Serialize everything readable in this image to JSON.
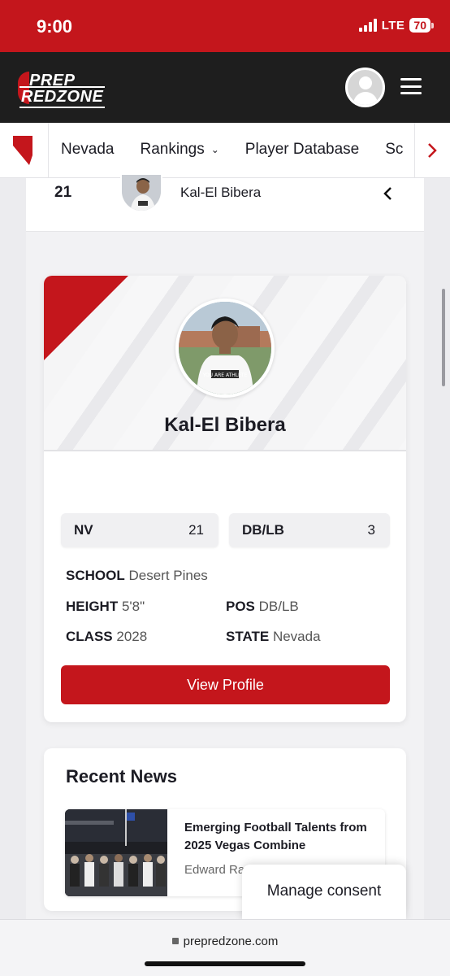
{
  "status_bar": {
    "time": "9:00",
    "network": "LTE",
    "battery": "70"
  },
  "header": {
    "logo_top": "PREP",
    "logo_bottom": "REDZONE"
  },
  "subnav": {
    "items": [
      "Nevada",
      "Rankings",
      "Player Database",
      "Sc"
    ]
  },
  "rank_row": {
    "rank": "21",
    "name": "Kal-El Bibera"
  },
  "player": {
    "name": "Kal-El Bibera",
    "state_abbr": "NV",
    "state_rank": "21",
    "position_group": "DB/LB",
    "position_rank": "3",
    "school_label": "SCHOOL",
    "school": "Desert Pines",
    "height_label": "HEIGHT",
    "height": "5'8\"",
    "pos_label": "POS",
    "pos": "DB/LB",
    "class_label": "CLASS",
    "class": "2028",
    "state_label": "STATE",
    "state": "Nevada",
    "view_profile": "View Profile",
    "shirt_text": "YOU ARE ATHLETE"
  },
  "news": {
    "heading": "Recent News",
    "items": [
      {
        "headline": "Emerging Football Talents from 2025 Vegas Combine",
        "author": "Edward Ra"
      }
    ]
  },
  "consent": {
    "label": "Manage consent"
  },
  "browser": {
    "url": "prepredzone.com"
  },
  "colors": {
    "brand_red": "#c4161c",
    "header_dark": "#1e1e1e"
  }
}
